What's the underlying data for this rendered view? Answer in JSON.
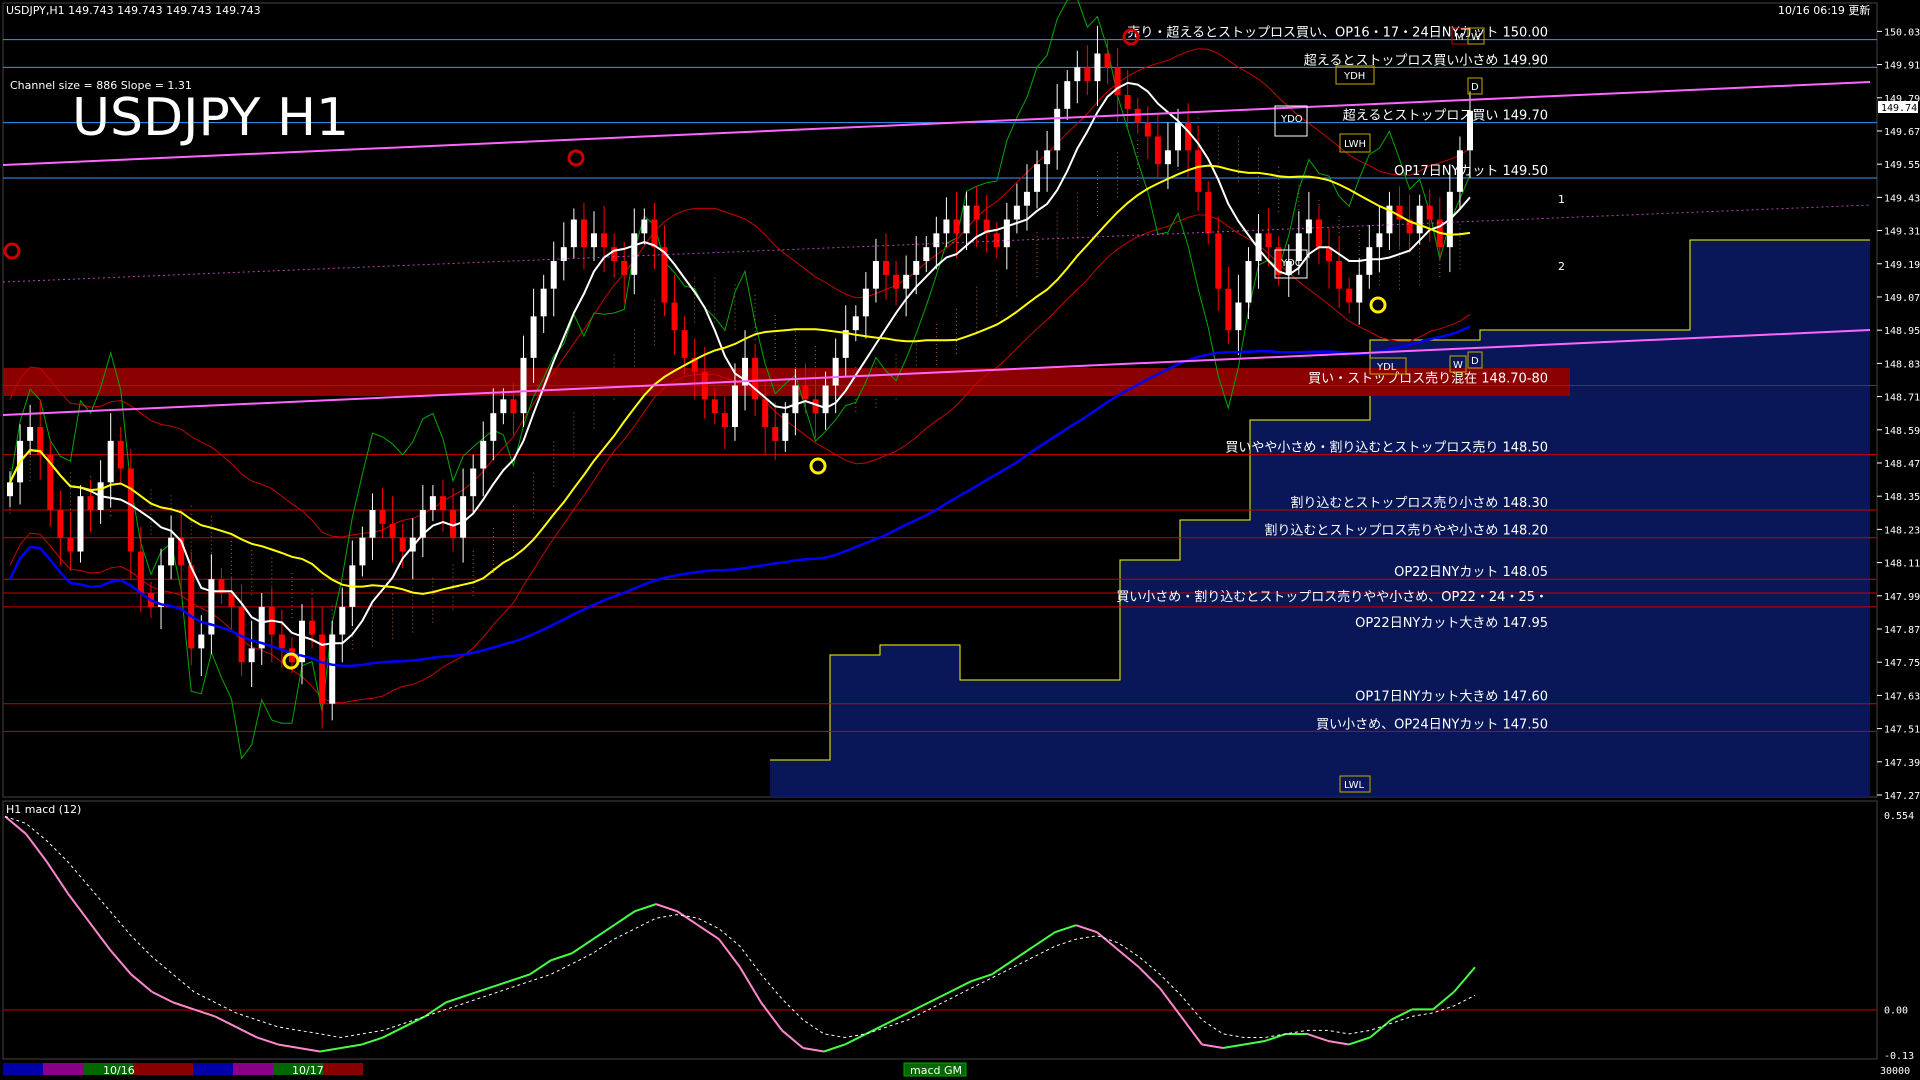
{
  "header": {
    "symbol_info": "USDJPY,H1  149.743 149.743 149.743 149.743",
    "datetime": "10/16 06:19 更新",
    "channel_info": "Channel size = 886 Slope = 1.31",
    "big_title": "USDJPY H1",
    "macd_label": "H1  macd (12)",
    "bottom_tag": "macd GM"
  },
  "colors": {
    "background": "#000000",
    "bull_candle": "#ffffff",
    "bear_candle": "#ff0000",
    "sma_fast": "#ffffff",
    "sma_mid": "#ffff00",
    "sma_slow": "#0000ff",
    "channel": "#ff66ff",
    "zone": "#8b0000",
    "bollinger": "#ff0000",
    "green_line": "#00cc00",
    "level_line": "#cc0000",
    "blue_line": "#3399ff",
    "macd_up": "#44ff44",
    "macd_down": "#ff88cc"
  },
  "levels": [
    {
      "text": "売り・超えるとストップロス買い、OP16・17・24日NYカット 150.00",
      "price": 150.0,
      "color": "#3399ff"
    },
    {
      "text": "超えるとストップロス買い小さめ 149.90",
      "price": 149.9,
      "color": "#3399ff"
    },
    {
      "text": "超えるとストップロス買い 149.70",
      "price": 149.7,
      "color": "#3399ff"
    },
    {
      "text": "OP17日NYカット 149.50",
      "price": 149.5,
      "color": "#3399ff"
    },
    {
      "text": "買い・ストップロス売り混在 148.70-80",
      "price": 148.75,
      "color": "#cc0000"
    },
    {
      "text": "買いやや小さめ・割り込むとストップロス売り 148.50",
      "price": 148.5,
      "color": "#cc0000"
    },
    {
      "text": "割り込むとストップロス売り小さめ 148.30",
      "price": 148.3,
      "color": "#cc0000"
    },
    {
      "text": "割り込むとストップロス売りやや小さめ 148.20",
      "price": 148.2,
      "color": "#cc0000"
    },
    {
      "text": "OP22日NYカット 148.05",
      "price": 148.05,
      "color": "#cc0000"
    },
    {
      "text": "買い小さめ・割り込むとストップロス売りやや小さめ、OP22・24・25・",
      "price": 148.0,
      "color": "#cc0000"
    },
    {
      "text": "OP22日NYカット大きめ 147.95",
      "price": 147.95,
      "color": "#cc0000"
    },
    {
      "text": "OP17日NYカット大きめ 147.60",
      "price": 147.6,
      "color": "#cc0000"
    },
    {
      "text": "買い小さめ、OP24日NYカット 147.50",
      "price": 147.5,
      "color": "#cc0000"
    }
  ],
  "boxes": [
    "YDH",
    "YDO",
    "YDC",
    "YDL",
    "LWH",
    "LWL",
    "M",
    "W",
    "D",
    "W",
    "D"
  ],
  "channel_labels": [
    "1",
    "2"
  ],
  "bottom_dates": [
    "10/16",
    "10/17"
  ],
  "chart_data": [
    {
      "type": "candlestick",
      "title": "USDJPY H1",
      "ylim": [
        147.27,
        150.053
      ],
      "y_ticks": [
        150.03,
        149.91,
        149.79,
        149.67,
        149.55,
        149.43,
        149.31,
        149.19,
        149.07,
        148.95,
        148.83,
        148.71,
        148.59,
        148.47,
        148.35,
        148.23,
        148.11,
        147.99,
        147.87,
        147.75,
        147.63,
        147.51,
        147.39,
        147.27
      ],
      "y_ticks_labels": [
        "150.030",
        "149.910",
        "149.790",
        "149.670",
        "149.550",
        "149.430",
        "149.310",
        "149.190",
        "149.070",
        "148.950",
        "148.830",
        "148.710",
        "148.590",
        "148.470",
        "148.350",
        "148.230",
        "148.110",
        "147.990",
        "147.870",
        "147.750",
        "147.630",
        "147.510",
        "147.390",
        "147.270"
      ],
      "current_price": 149.743,
      "current_price_label": "149.743",
      "closes": [
        148.4,
        148.55,
        148.6,
        148.5,
        148.3,
        148.2,
        148.15,
        148.35,
        148.3,
        148.4,
        148.55,
        148.45,
        148.15,
        148.0,
        147.95,
        148.1,
        148.2,
        148.1,
        147.8,
        147.85,
        148.05,
        148.0,
        147.95,
        147.75,
        147.8,
        147.95,
        147.85,
        147.8,
        147.75,
        147.9,
        147.85,
        147.6,
        147.85,
        147.95,
        148.1,
        148.2,
        148.3,
        148.25,
        148.2,
        148.15,
        148.2,
        148.3,
        148.35,
        148.3,
        148.2,
        148.35,
        148.45,
        148.55,
        148.65,
        148.7,
        148.65,
        148.85,
        149.0,
        149.1,
        149.2,
        149.25,
        149.35,
        149.25,
        149.3,
        149.25,
        149.2,
        149.15,
        149.3,
        149.35,
        149.25,
        149.05,
        148.95,
        148.85,
        148.8,
        148.7,
        148.65,
        148.6,
        148.75,
        148.85,
        148.7,
        148.6,
        148.55,
        148.65,
        148.75,
        148.7,
        148.65,
        148.75,
        148.85,
        148.95,
        149.0,
        149.1,
        149.2,
        149.15,
        149.1,
        149.15,
        149.2,
        149.25,
        149.3,
        149.35,
        149.3,
        149.4,
        149.35,
        149.3,
        149.25,
        149.35,
        149.4,
        149.45,
        149.55,
        149.6,
        149.75,
        149.85,
        149.9,
        149.85,
        149.95,
        149.9,
        149.8,
        149.75,
        149.7,
        149.65,
        149.55,
        149.6,
        149.7,
        149.6,
        149.45,
        149.3,
        149.1,
        148.95,
        149.05,
        149.2,
        149.3,
        149.25,
        149.15,
        149.2,
        149.3,
        149.35,
        149.25,
        149.2,
        149.1,
        149.05,
        149.15,
        149.25,
        149.3,
        149.4,
        149.35,
        149.3,
        149.4,
        149.35,
        149.25,
        149.45,
        149.6,
        149.743
      ],
      "series": [
        {
          "name": "",
          "kind": "sma_fast"
        },
        {
          "name": "",
          "kind": "sma_mid"
        },
        {
          "name": "",
          "kind": "sma_slow"
        }
      ]
    },
    {
      "type": "line",
      "title": "H1  macd (12)",
      "ylim": [
        -0.13,
        0.554
      ],
      "y_ticks": [
        0.554,
        0.0,
        -0.13
      ],
      "y_ticks_labels": [
        "0.554",
        "0.00",
        "-0.13"
      ],
      "macd": [
        0.55,
        0.5,
        0.42,
        0.33,
        0.25,
        0.17,
        0.1,
        0.05,
        0.02,
        0.0,
        -0.02,
        -0.05,
        -0.08,
        -0.1,
        -0.11,
        -0.12,
        -0.11,
        -0.1,
        -0.08,
        -0.05,
        -0.02,
        0.02,
        0.04,
        0.06,
        0.08,
        0.1,
        0.14,
        0.16,
        0.2,
        0.24,
        0.28,
        0.3,
        0.28,
        0.24,
        0.2,
        0.12,
        0.02,
        -0.06,
        -0.11,
        -0.12,
        -0.1,
        -0.07,
        -0.04,
        -0.01,
        0.02,
        0.05,
        0.08,
        0.1,
        0.14,
        0.18,
        0.22,
        0.24,
        0.22,
        0.17,
        0.12,
        0.06,
        -0.02,
        -0.1,
        -0.11,
        -0.1,
        -0.09,
        -0.07,
        -0.07,
        -0.09,
        -0.1,
        -0.08,
        -0.03,
        0.0,
        0.0,
        0.05,
        0.12
      ],
      "signal": [
        0.55,
        0.53,
        0.48,
        0.42,
        0.35,
        0.28,
        0.21,
        0.15,
        0.1,
        0.05,
        0.02,
        -0.01,
        -0.03,
        -0.05,
        -0.06,
        -0.07,
        -0.08,
        -0.07,
        -0.06,
        -0.04,
        -0.02,
        0.0,
        0.02,
        0.04,
        0.06,
        0.08,
        0.1,
        0.13,
        0.16,
        0.2,
        0.23,
        0.26,
        0.27,
        0.26,
        0.23,
        0.18,
        0.1,
        0.03,
        -0.03,
        -0.07,
        -0.08,
        -0.07,
        -0.05,
        -0.03,
        0.0,
        0.03,
        0.06,
        0.09,
        0.12,
        0.15,
        0.18,
        0.2,
        0.21,
        0.19,
        0.15,
        0.1,
        0.04,
        -0.03,
        -0.07,
        -0.08,
        -0.08,
        -0.07,
        -0.06,
        -0.06,
        -0.07,
        -0.06,
        -0.04,
        -0.02,
        -0.01,
        0.01,
        0.04
      ]
    }
  ],
  "bottom_axis_label": "30000"
}
